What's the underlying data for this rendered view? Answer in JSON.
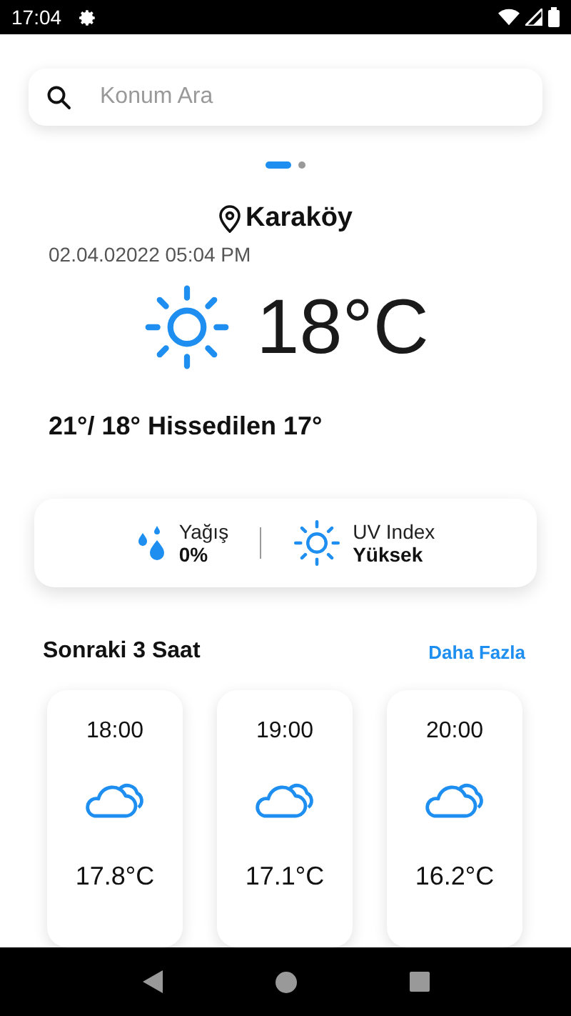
{
  "status_bar": {
    "time": "17:04"
  },
  "search": {
    "placeholder": "Konum Ara"
  },
  "pages": [
    {
      "selected": true
    },
    {
      "selected": false
    }
  ],
  "location": {
    "name": "Karaköy",
    "datetime": "02.04.02022 05:04 PM"
  },
  "current": {
    "temperature": "18°C",
    "summary": "21°/ 18° Hissedilen 17°"
  },
  "details": [
    {
      "label": "Yağış",
      "value": "0%",
      "kind": "rain"
    },
    {
      "label": "UV Index",
      "value": "Yüksek",
      "kind": "uv"
    }
  ],
  "forecast": {
    "title": "Sonraki 3 Saat",
    "link": "Daha Fazla",
    "hours": [
      {
        "time": "18:00",
        "temperature": "17.8°C"
      },
      {
        "time": "19:00",
        "temperature": "17.1°C"
      },
      {
        "time": "20:00",
        "temperature": "16.2°C"
      }
    ]
  }
}
